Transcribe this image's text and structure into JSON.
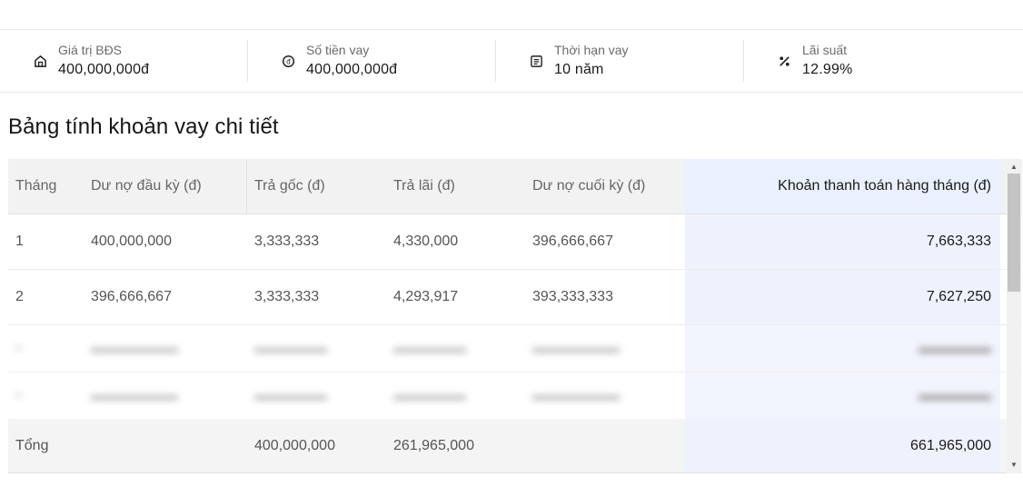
{
  "summary": [
    {
      "icon": "house-icon",
      "label": "Giá trị BĐS",
      "value": "400,000,000đ"
    },
    {
      "icon": "money-icon",
      "label": "Số tiền vay",
      "value": "400,000,000đ"
    },
    {
      "icon": "calendar-icon",
      "label": "Thời hạn vay",
      "value": "10 năm"
    },
    {
      "icon": "percent-icon",
      "label": "Lãi suất",
      "value": "12.99%"
    }
  ],
  "section_title": "Bảng tính khoản vay chi tiết",
  "table": {
    "headers": [
      "Tháng",
      "Dư nợ đầu kỳ (đ)",
      "Trả gốc (đ)",
      "Trả lãi (đ)",
      "Dư nợ cuối kỳ (đ)",
      "Khoản thanh toán hàng tháng (đ)"
    ],
    "rows": [
      [
        "1",
        "400,000,000",
        "3,333,333",
        "4,330,000",
        "396,666,667",
        "7,663,333"
      ],
      [
        "2",
        "396,666,667",
        "3,333,333",
        "4,293,917",
        "393,333,333",
        "7,627,250"
      ]
    ],
    "total": [
      "Tổng",
      "",
      "400,000,000",
      "261,965,000",
      "",
      "661,965,000"
    ]
  },
  "colors": {
    "highlight_column": "#eef2fd",
    "header_bg": "#f2f2f2"
  }
}
